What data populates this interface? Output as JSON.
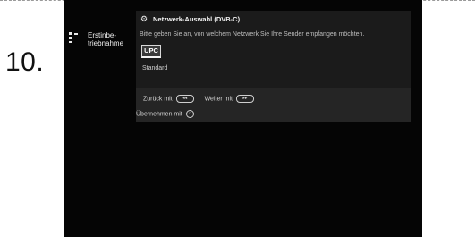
{
  "step_number": "10.",
  "sidebar": {
    "item_label": "Erstinbe-triebnahme"
  },
  "panel": {
    "title": "Netzwerk-Auswahl (DVB-C)",
    "description": "Bitte geben Sie an, von welchem Netzwerk Sie Ihre Sender empfangen möchten.",
    "options": [
      {
        "label": "UPC",
        "selected": true
      },
      {
        "label": "Standard",
        "selected": false
      }
    ]
  },
  "navigation": {
    "back_label": "Zurück mit",
    "back_key": "◂◂",
    "next_label": "Weiter mit",
    "next_key": "▸▸",
    "apply_label": "Übernehmen mit",
    "apply_key": "○"
  },
  "icons": {
    "sidebar": "setup-grid-icon",
    "header": "gear-icon"
  }
}
